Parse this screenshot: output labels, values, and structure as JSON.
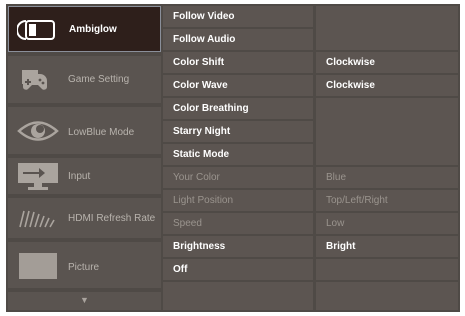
{
  "left_menu": {
    "items": [
      {
        "label": "Ambiglow",
        "icon": "ambiglow-icon",
        "selected": true
      },
      {
        "label": "Game Setting",
        "icon": "gamepad-icon",
        "selected": false
      },
      {
        "label": "LowBlue Mode",
        "icon": "eye-icon",
        "selected": false
      },
      {
        "label": "Input",
        "icon": "input-icon",
        "selected": false
      },
      {
        "label": "HDMI Refresh Rate",
        "icon": "refresh-rate-icon",
        "selected": false
      },
      {
        "label": "Picture",
        "icon": "picture-icon",
        "selected": false
      }
    ],
    "more_arrow": "▼"
  },
  "submenu": {
    "rows": [
      {
        "label": "Follow Video",
        "state": "active",
        "value": ""
      },
      {
        "label": "Follow Audio",
        "state": "active",
        "value": ""
      },
      {
        "label": "Color Shift",
        "state": "active",
        "value": "Clockwise"
      },
      {
        "label": "Color Wave",
        "state": "active",
        "value": "Clockwise"
      },
      {
        "label": "Color Breathing",
        "state": "active",
        "value": ""
      },
      {
        "label": "Starry Night",
        "state": "active",
        "value": ""
      },
      {
        "label": "Static Mode",
        "state": "active",
        "value": ""
      },
      {
        "label": "Your Color",
        "state": "disabled",
        "value": "Blue"
      },
      {
        "label": "Light Position",
        "state": "disabled",
        "value": "Top/Left/Right"
      },
      {
        "label": "Speed",
        "state": "disabled",
        "value": "Low"
      },
      {
        "label": "Brightness",
        "state": "active",
        "value": "Bright"
      },
      {
        "label": "Off",
        "state": "active",
        "value": ""
      }
    ]
  },
  "colors": {
    "panel": "#4f4a46",
    "cell": "#5c5551",
    "selected_bg": "#2e1f1b",
    "active_text": "#ffffff",
    "disabled_text": "#9a948e"
  }
}
